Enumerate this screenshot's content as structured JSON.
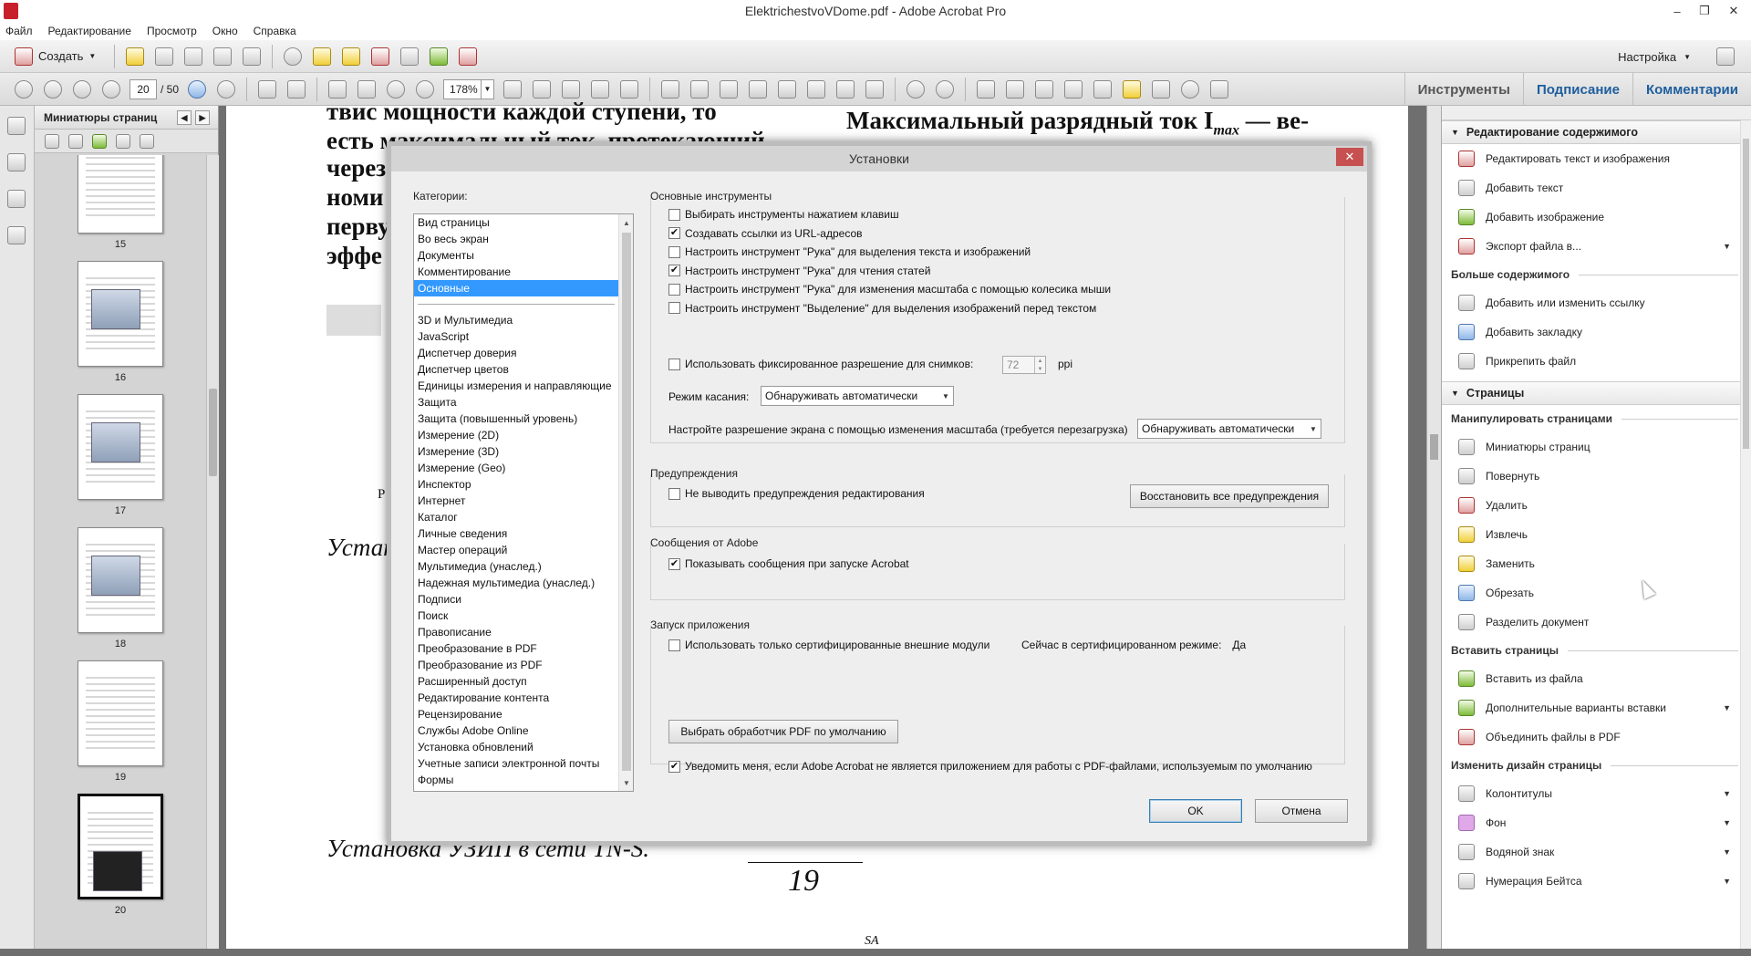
{
  "window": {
    "title": "ElektrichestvoVDome.pdf - Adobe Acrobat Pro",
    "minimize": "–",
    "maximize": "❐",
    "close": "✕"
  },
  "menu": [
    "Файл",
    "Редактирование",
    "Просмотр",
    "Окно",
    "Справка"
  ],
  "toolbar": {
    "create_label": "Создать",
    "settings_label": "Настройка",
    "page_current": "20",
    "page_total": "/ 50",
    "zoom": "178%"
  },
  "right_tabs": [
    "Инструменты",
    "Подписание",
    "Комментарии"
  ],
  "thumbnails": {
    "title": "Миниатюры страниц",
    "pages": [
      "15",
      "16",
      "17",
      "18",
      "19",
      "20"
    ],
    "current": "20"
  },
  "document": {
    "lines_left": [
      "твис мощности каждой ступени, то",
      "есть максимальный ток, протекающий",
      "через",
      "номи",
      "перву",
      "эффе"
    ],
    "line_right": "Максимальный разрядный ток I",
    "line_right_sub": "max",
    "line_right_tail": " — ве-",
    "fragment_r": "Р",
    "fragment_ustan": "Устан",
    "caption_bottom": "Установка УЗИП в сети TN-S.",
    "page_number": "19",
    "footer_mark": "SA"
  },
  "dialog": {
    "title": "Установки",
    "close": "✕",
    "categories_label": "Категории:",
    "categories_top": [
      "Вид страницы",
      "Во весь экран",
      "Документы",
      "Комментирование",
      "Основные"
    ],
    "categories_selected": "Основные",
    "categories_rest": [
      "3D и Мультимедиа",
      "JavaScript",
      "Диспетчер доверия",
      "Диспетчер цветов",
      "Единицы измерения и направляющие",
      "Защита",
      "Защита (повышенный уровень)",
      "Измерение (2D)",
      "Измерение (3D)",
      "Измерение (Geo)",
      "Инспектор",
      "Интернет",
      "Каталог",
      "Личные сведения",
      "Мастер операций",
      "Мультимедиа (унаслед.)",
      "Надежная мультимедиа (унаслед.)",
      "Подписи",
      "Поиск",
      "Правописание",
      "Преобразование в PDF",
      "Преобразование из PDF",
      "Расширенный доступ",
      "Редактирование контента",
      "Рецензирование",
      "Службы Adobe Online",
      "Установка обновлений",
      "Учетные записи электронной почты",
      "Формы"
    ],
    "basic_tools": {
      "title": "Основные инструменты",
      "options": [
        {
          "label": "Выбирать инструменты нажатием клавиш",
          "checked": false
        },
        {
          "label": "Создавать ссылки из URL-адресов",
          "checked": true
        },
        {
          "label": "Настроить инструмент \"Рука\" для выделения текста и изображений",
          "checked": false
        },
        {
          "label": "Настроить инструмент \"Рука\" для чтения статей",
          "checked": true
        },
        {
          "label": "Настроить инструмент \"Рука\" для изменения масштаба с помощью колесика мыши",
          "checked": false
        },
        {
          "label": "Настроить инструмент \"Выделение\" для выделения изображений перед текстом",
          "checked": false
        }
      ],
      "fixed_res_label": "Использовать фиксированное разрешение для снимков:",
      "fixed_res_value": "72",
      "fixed_res_unit": "ppi",
      "touch_mode_label": "Режим касания:",
      "touch_mode_value": "Обнаруживать автоматически",
      "screen_res_label": "Настройте разрешение экрана с помощью изменения масштаба (требуется перезагрузка)",
      "screen_res_value": "Обнаруживать автоматически"
    },
    "warnings": {
      "title": "Предупреждения",
      "option": "Не выводить предупреждения редактирования",
      "restore_button": "Восстановить все предупреждения"
    },
    "adobe_messages": {
      "title": "Сообщения от Adobe",
      "option": "Показывать сообщения при запуске Acrobat"
    },
    "startup": {
      "title": "Запуск приложения",
      "cert_option": "Использовать только сертифицированные внешние модули",
      "cert_mode_label": "Сейчас в сертифицированном режиме:",
      "cert_mode_value": "Да",
      "default_handler_button": "Выбрать обработчик PDF по умолчанию",
      "notify_option": "Уведомить меня, если Adobe Acrobat не является приложением для работы с PDF-файлами, используемым по умолчанию"
    },
    "ok": "OK",
    "cancel": "Отмена"
  },
  "right_panel": {
    "sections": [
      {
        "title": "Редактирование содержимого",
        "items": [
          "Редактировать текст и изображения",
          "Добавить текст",
          "Добавить изображение",
          "Экспорт файла в..."
        ]
      },
      {
        "subtitle": "Больше содержимого",
        "items": [
          "Добавить или изменить ссылку",
          "Добавить закладку",
          "Прикрепить файл"
        ]
      },
      {
        "title": "Страницы"
      },
      {
        "subtitle": "Манипулировать страницами",
        "items": [
          "Миниатюры страниц",
          "Повернуть",
          "Удалить",
          "Извлечь",
          "Заменить",
          "Обрезать",
          "Разделить документ"
        ]
      },
      {
        "subtitle": "Вставить страницы",
        "items": [
          "Вставить из файла",
          "Дополнительные варианты вставки",
          "Объединить файлы в PDF"
        ]
      },
      {
        "subtitle": "Изменить дизайн страницы",
        "items": [
          "Колонтитулы",
          "Фон",
          "Водяной знак",
          "Нумерация Бейтса"
        ]
      }
    ]
  }
}
